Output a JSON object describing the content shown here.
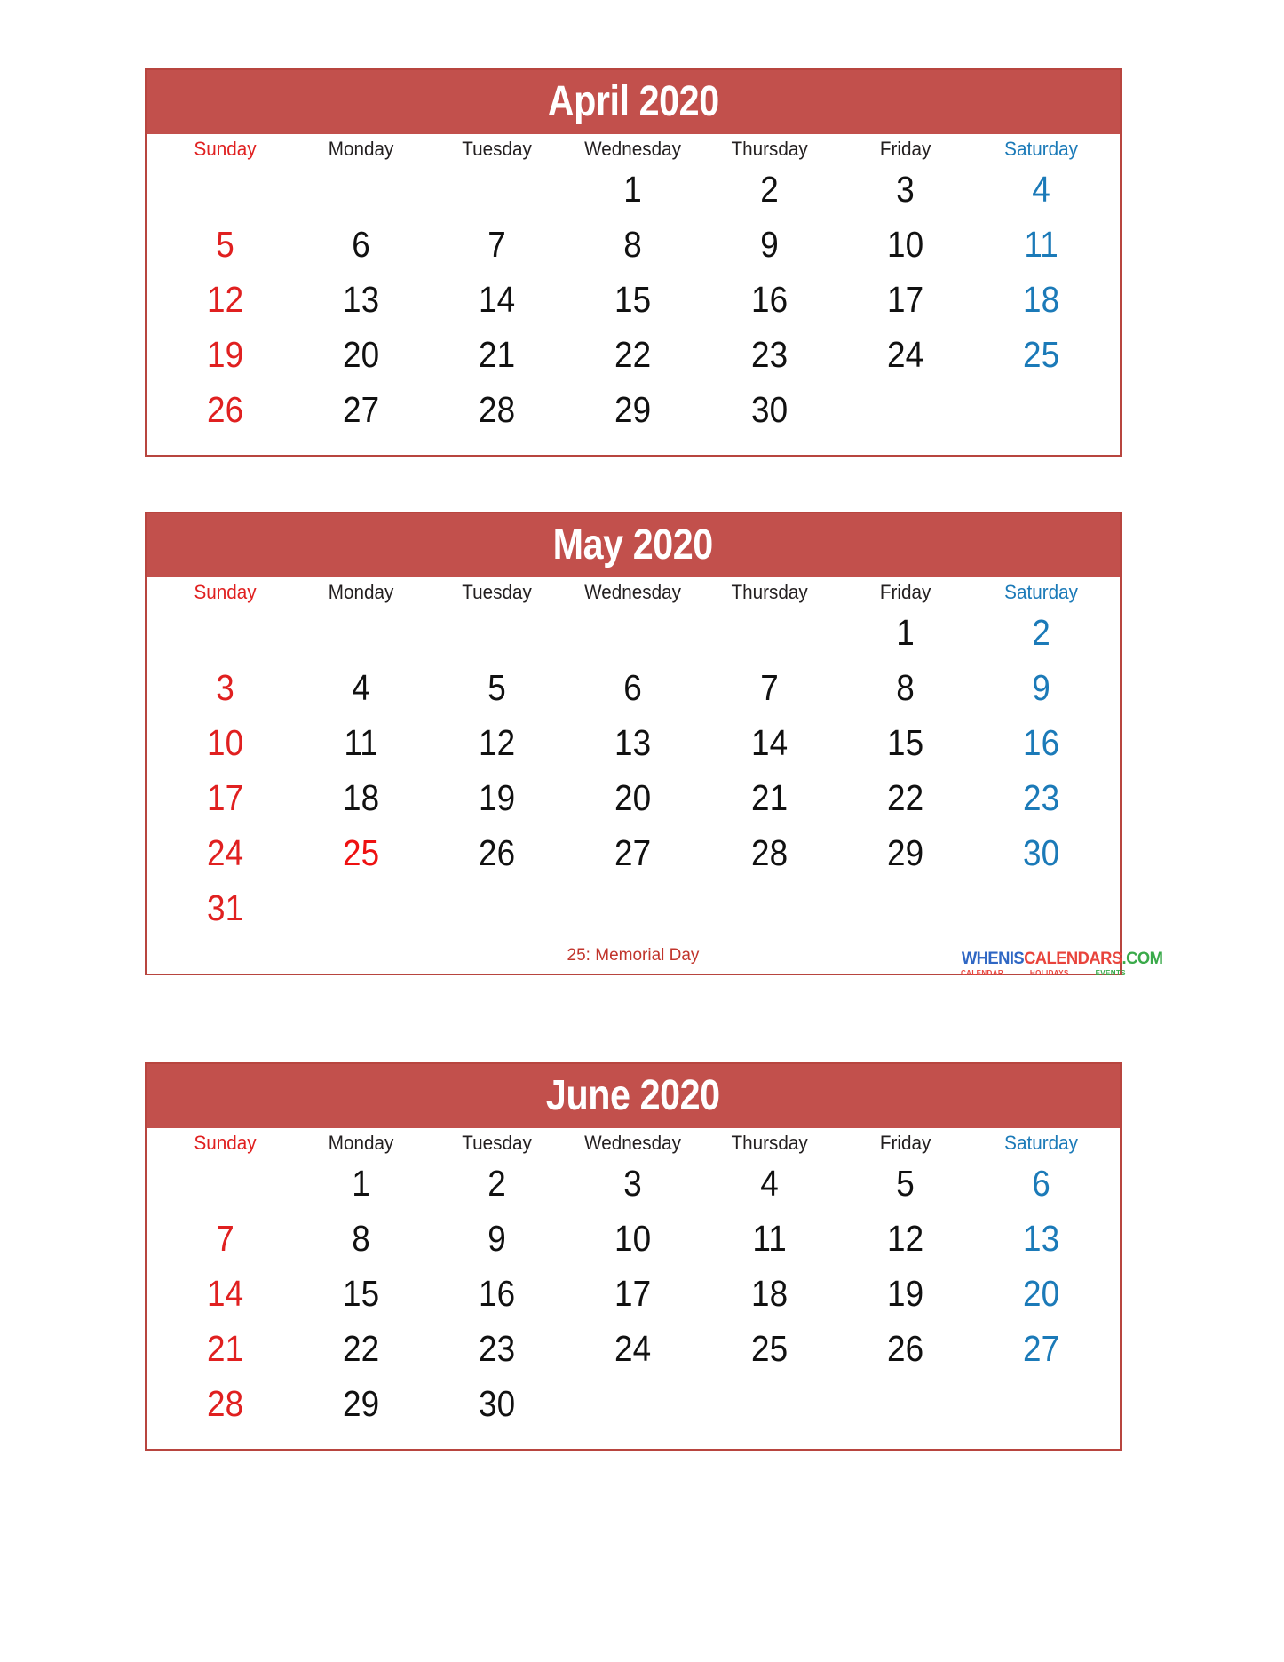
{
  "colors": {
    "header_bg": "#c2504c",
    "border": "#b8453f",
    "sunday": "#e02020",
    "saturday": "#1b7ab8",
    "weekday": "#231f20",
    "note": "#c1352c"
  },
  "weekdays": [
    "Sunday",
    "Monday",
    "Tuesday",
    "Wednesday",
    "Thursday",
    "Friday",
    "Saturday"
  ],
  "months": [
    {
      "title": "April 2020",
      "weeks": [
        [
          "",
          "",
          "",
          "1",
          "2",
          "3",
          "4"
        ],
        [
          "5",
          "6",
          "7",
          "8",
          "9",
          "10",
          "11"
        ],
        [
          "12",
          "13",
          "14",
          "15",
          "16",
          "17",
          "18"
        ],
        [
          "19",
          "20",
          "21",
          "22",
          "23",
          "24",
          "25"
        ],
        [
          "26",
          "27",
          "28",
          "29",
          "30",
          "",
          ""
        ]
      ],
      "holidays": [],
      "notes": ""
    },
    {
      "title": "May 2020",
      "weeks": [
        [
          "",
          "",
          "",
          "",
          "",
          "1",
          "2"
        ],
        [
          "3",
          "4",
          "5",
          "6",
          "7",
          "8",
          "9"
        ],
        [
          "10",
          "11",
          "12",
          "13",
          "14",
          "15",
          "16"
        ],
        [
          "17",
          "18",
          "19",
          "20",
          "21",
          "22",
          "23"
        ],
        [
          "24",
          "25",
          "26",
          "27",
          "28",
          "29",
          "30"
        ],
        [
          "31",
          "",
          "",
          "",
          "",
          "",
          ""
        ]
      ],
      "holidays": [
        "25"
      ],
      "notes": "25: Memorial Day"
    },
    {
      "title": "June 2020",
      "weeks": [
        [
          "",
          "1",
          "2",
          "3",
          "4",
          "5",
          "6"
        ],
        [
          "7",
          "8",
          "9",
          "10",
          "11",
          "12",
          "13"
        ],
        [
          "14",
          "15",
          "16",
          "17",
          "18",
          "19",
          "20"
        ],
        [
          "21",
          "22",
          "23",
          "24",
          "25",
          "26",
          "27"
        ],
        [
          "28",
          "29",
          "30",
          "",
          "",
          "",
          ""
        ]
      ],
      "holidays": [],
      "notes": ""
    }
  ],
  "logo": {
    "part1": "WHENIS",
    "part2": "CALENDARS",
    "part3": ".COM",
    "sub1": "CALENDAR",
    "sub2": "HOLIDAYS",
    "sub3": "EVENTS"
  }
}
